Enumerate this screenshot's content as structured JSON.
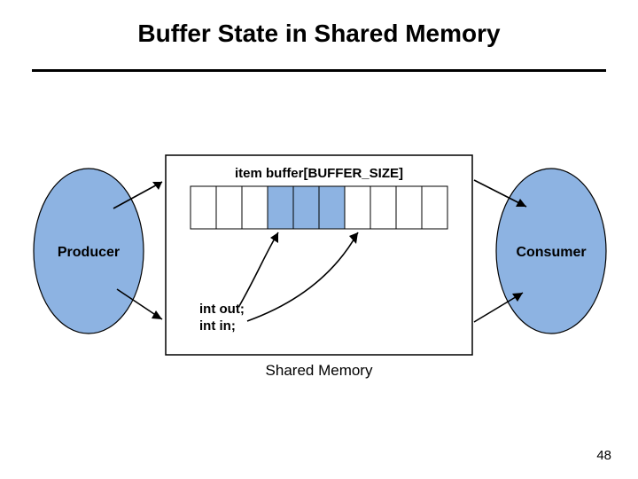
{
  "title": "Buffer State in Shared Memory",
  "producer_label": "Producer",
  "consumer_label": "Consumer",
  "buffer_decl": "item buffer[BUFFER_SIZE]",
  "var_out": "int out;",
  "var_in": "int in;",
  "shared_memory_label": "Shared Memory",
  "page_number": "48",
  "buffer_cells_filled": [
    false,
    false,
    false,
    true,
    true,
    true,
    false,
    false,
    false,
    false
  ],
  "colors": {
    "ellipse_fill": "#8db3e2",
    "cell_fill": "#8db3e2"
  }
}
